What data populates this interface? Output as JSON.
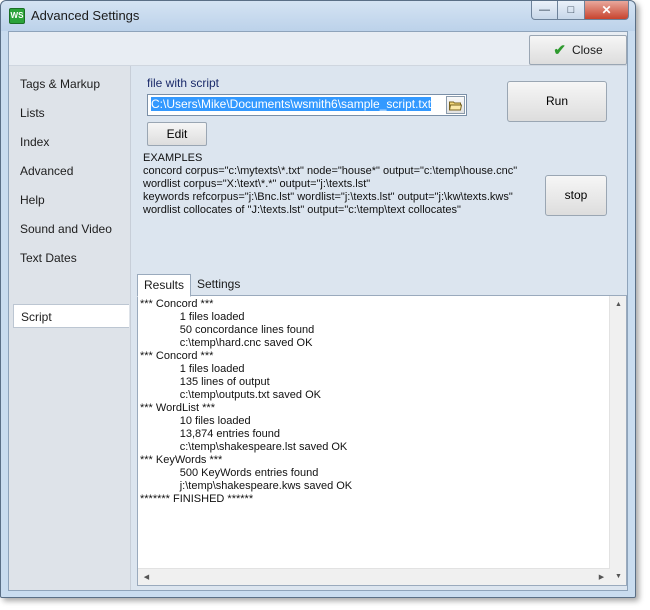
{
  "window": {
    "title": "Advanced Settings",
    "app_icon_text": "WS",
    "minimize_glyph": "—",
    "maximize_glyph": "□",
    "close_glyph": "✕"
  },
  "toolbar": {
    "close_label": "Close"
  },
  "sidebar": {
    "items": [
      {
        "label": "Tags & Markup"
      },
      {
        "label": "Lists"
      },
      {
        "label": "Index"
      },
      {
        "label": "Advanced"
      },
      {
        "label": "Help"
      },
      {
        "label": "Sound and Video"
      },
      {
        "label": "Text Dates"
      },
      {
        "label": "Script"
      }
    ],
    "selected": "Script"
  },
  "script": {
    "file_label": "file with script",
    "file_path": "C:\\Users\\Mike\\Documents\\wsmith6\\sample_script.txt",
    "edit_label": "Edit",
    "run_label": "Run",
    "stop_label": "stop",
    "examples_heading": "EXAMPLES",
    "examples": [
      "concord corpus=\"c:\\mytexts\\*.txt\" node=\"house*\" output=\"c:\\temp\\house.cnc\"",
      "wordlist corpus=\"X:\\text\\*.*\" output=\"j:\\texts.lst\"",
      "keywords refcorpus=\"j:\\Bnc.lst\" wordlist=\"j:\\texts.lst\" output=\"j:\\kw\\texts.kws\"",
      "wordlist collocates of \"J:\\texts.lst\" output=\"c:\\temp\\text collocates\""
    ]
  },
  "tabs": [
    {
      "label": "Results"
    },
    {
      "label": "Settings"
    }
  ],
  "results": {
    "lines": [
      "*** Concord ***",
      "             1 files loaded",
      "             50 concordance lines found",
      "             c:\\temp\\hard.cnc saved OK",
      "*** Concord ***",
      "             1 files loaded",
      "             135 lines of output",
      "             c:\\temp\\outputs.txt saved OK",
      "*** WordList ***",
      "             10 files loaded",
      "             13,874 entries found",
      "             c:\\temp\\shakespeare.lst saved OK",
      "*** KeyWords ***",
      "             500 KeyWords entries found",
      "             j:\\temp\\shakespeare.kws saved OK",
      "******* FINISHED ******"
    ]
  },
  "colors": {
    "accent_selection": "#3399ff",
    "check_green": "#2f9a2f",
    "window_frame": "#c9dcef"
  },
  "icons": {
    "app": "wordsmith-app-icon",
    "close": "green-check-icon",
    "browse": "open-folder-icon"
  }
}
